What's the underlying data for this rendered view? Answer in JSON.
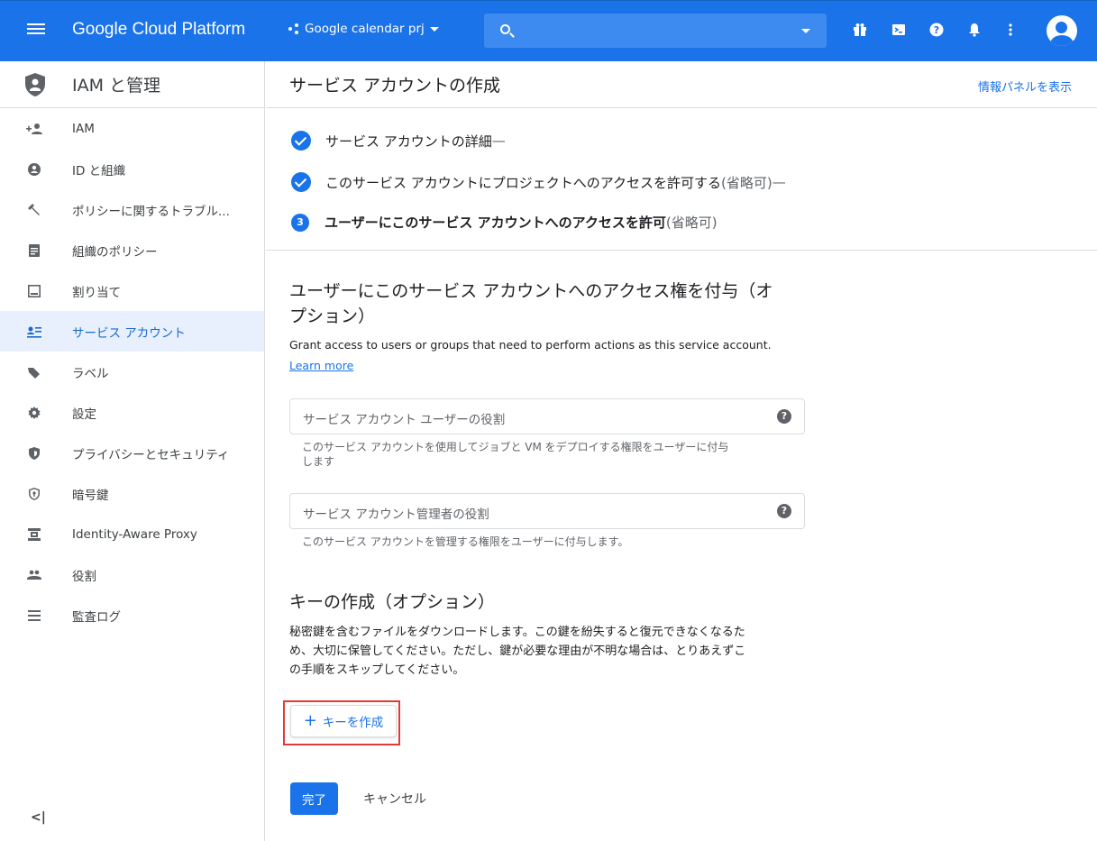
{
  "topbar": {
    "brand": "Google Cloud Platform",
    "project": "Google calendar prj",
    "icons": [
      "gift-icon",
      "cloud-shell-icon",
      "help-icon",
      "notifications-icon",
      "more-vert-icon",
      "account-avatar-icon"
    ]
  },
  "sidebar": {
    "title": "IAM と管理",
    "items": [
      {
        "label": "IAM",
        "icon": "add-person-icon"
      },
      {
        "label": "ID と組織",
        "icon": "account-circle-icon"
      },
      {
        "label": "ポリシーに関するトラブル...",
        "icon": "wrench-icon"
      },
      {
        "label": "組織のポリシー",
        "icon": "document-icon"
      },
      {
        "label": "割り当て",
        "icon": "quota-icon"
      },
      {
        "label": "サービス アカウント",
        "icon": "service-account-icon",
        "active": true
      },
      {
        "label": "ラベル",
        "icon": "label-icon"
      },
      {
        "label": "設定",
        "icon": "gear-icon"
      },
      {
        "label": "プライバシーとセキュリティ",
        "icon": "shield-icon"
      },
      {
        "label": "暗号鍵",
        "icon": "key-shield-icon"
      },
      {
        "label": "Identity-Aware Proxy",
        "icon": "proxy-icon"
      },
      {
        "label": "役割",
        "icon": "roles-icon"
      },
      {
        "label": "監査ログ",
        "icon": "list-icon"
      }
    ],
    "collapse_label": "<|"
  },
  "main": {
    "title": "サービス アカウントの作成",
    "info_panel_link": "情報パネルを表示",
    "steps": [
      {
        "text": "サービス アカウントの詳細",
        "suffix": " —"
      },
      {
        "text": "このサービス アカウントにプロジェクトへのアクセスを許可する",
        "optional": " (省略可)",
        "suffix": " —"
      },
      {
        "number": "3",
        "text": "ユーザーにこのサービス アカウントへのアクセスを許可",
        "optional": " (省略可)"
      }
    ],
    "grant_section": {
      "title_line1": "ユーザーにこのサービス アカウントへのアクセス権を付与（オ",
      "title_line2": "プション）",
      "description": "Grant access to users or groups that need to perform actions as this service account.",
      "learn_more": "Learn more",
      "field1_placeholder": "サービス アカウント ユーザーの役割",
      "field1_hint_line1": "このサービス アカウントを使用してジョブと VM をデプロイする権限をユーザーに付与",
      "field1_hint_line2": "します",
      "field2_placeholder": "サービス アカウント管理者の役割",
      "field2_hint": "このサービス アカウントを管理する権限をユーザーに付与します。"
    },
    "key_section": {
      "title": "キーの作成（オプション）",
      "line1": "秘密鍵を含むファイルをダウンロードします。この鍵を紛失すると復元できなくなるた",
      "line2": "め、大切に保管してください。ただし、鍵が必要な理由が不明な場合は、とりあえずこ",
      "line3": "の手順をスキップしてください。",
      "create_key_button": "キーを作成"
    },
    "done_button": "完了",
    "cancel_button": "キャンセル"
  }
}
